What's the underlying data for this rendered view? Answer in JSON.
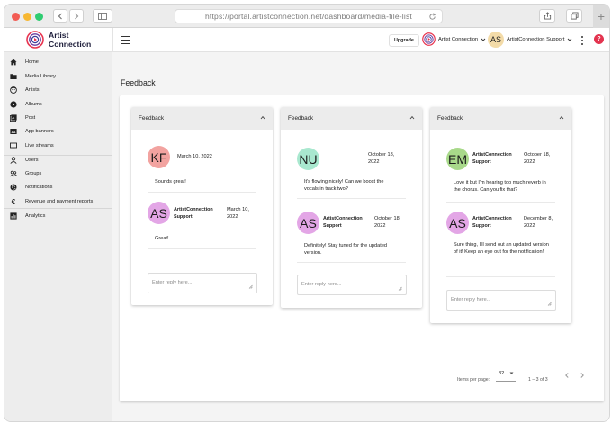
{
  "browser": {
    "url": "https://portal.artistconnection.net/dashboard/media-file-list"
  },
  "header": {
    "logo_line1": "Artist",
    "logo_line2": "Connection",
    "upgrade_label": "Upgrade",
    "artist_label": "Artist Connection",
    "user_initials": "AS",
    "user_label": "ArtistConnection Support",
    "help_label": "?"
  },
  "sidebar": {
    "items": [
      {
        "label": "Home",
        "icon": "home-icon"
      },
      {
        "label": "Media Library",
        "icon": "folder-icon"
      },
      {
        "label": "Artists",
        "icon": "face-icon"
      },
      {
        "label": "Albums",
        "icon": "album-icon"
      },
      {
        "label": "Post",
        "icon": "post-icon"
      },
      {
        "label": "App banners",
        "icon": "banner-icon"
      },
      {
        "label": "Live streams",
        "icon": "tv-icon"
      },
      {
        "label": "Users",
        "icon": "user-icon"
      },
      {
        "label": "Groups",
        "icon": "groups-icon"
      },
      {
        "label": "Notifications",
        "icon": "globe-icon"
      },
      {
        "label": "Revenue and payment reports",
        "icon": "euro-icon"
      },
      {
        "label": "Analytics",
        "icon": "analytics-icon"
      }
    ]
  },
  "main": {
    "title": "Feedback",
    "cards": [
      {
        "title": "Feedback",
        "messages": [
          {
            "initials": "KF",
            "name": "",
            "date": "March 10, 2022",
            "text": "Sounds great!",
            "color": "#f2a3a0"
          },
          {
            "initials": "AS",
            "name": "ArtistConnection Support",
            "date": "March 10, 2022",
            "text": "Great!",
            "color": "#e3a6e6"
          }
        ],
        "reply_placeholder": "Enter reply here..."
      },
      {
        "title": "Feedback",
        "messages": [
          {
            "initials": "NU",
            "name": "",
            "date": "October 18, 2022",
            "text": "It's flowing nicely! Can we boost the vocals in track two?",
            "color": "#a9e8cf"
          },
          {
            "initials": "AS",
            "name": "ArtistConnection Support",
            "date": "October 18, 2022",
            "text": "Definitely! Stay tuned for the updated version.",
            "color": "#e3a6e6"
          }
        ],
        "reply_placeholder": "Enter reply here..."
      },
      {
        "title": "Feedback",
        "messages": [
          {
            "initials": "EM",
            "name": "ArtistConnection Support",
            "date": "October 18, 2022",
            "text": "Love it but I'm hearing too much reverb in the chorus. Can you fix that?",
            "color": "#a8d98a"
          },
          {
            "initials": "AS",
            "name": "ArtistConnection Support",
            "date": "December 8, 2022",
            "text": "Sure thing, I'll send out an updated version of it! Keep an eye out for the notification!",
            "color": "#e3a6e6"
          }
        ],
        "reply_placeholder": "Enter reply here..."
      }
    ],
    "pagination": {
      "items_per_page_label": "Items per page:",
      "items_per_page_value": "32",
      "range_label": "1 – 3 of 3"
    }
  },
  "colors": {
    "help_red": "#e3344f",
    "user_avatar_bg": "#f3dba8",
    "logo_red": "#e8344f",
    "logo_purple": "#6b3fa0"
  }
}
